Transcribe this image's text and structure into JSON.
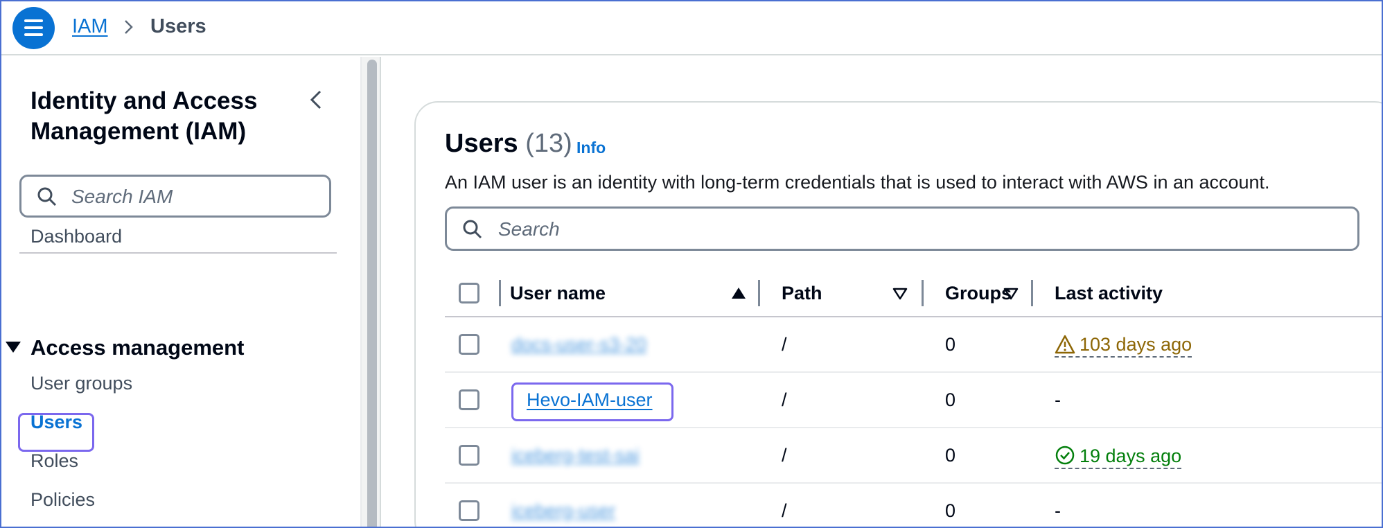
{
  "breadcrumb": {
    "root": "IAM",
    "current": "Users"
  },
  "sidebar": {
    "title": "Identity and Access Management (IAM)",
    "search_placeholder": "Search IAM",
    "dashboard": "Dashboard",
    "section_heading": "Access management",
    "items": [
      {
        "label": "User groups"
      },
      {
        "label": "Users",
        "active": true
      },
      {
        "label": "Roles"
      },
      {
        "label": "Policies"
      }
    ]
  },
  "main": {
    "title": "Users",
    "count": "(13)",
    "info_label": "Info",
    "description": "An IAM user is an identity with long-term credentials that is used to interact with AWS in an account.",
    "search_placeholder": "Search",
    "columns": {
      "user_name": "User name",
      "path": "Path",
      "groups": "Groups",
      "last_activity": "Last activity"
    },
    "rows": [
      {
        "user_name": "docs-user-s3-20",
        "blurred": true,
        "path": "/",
        "groups": "0",
        "last_activity": "103 days ago",
        "activity_status": "warning"
      },
      {
        "user_name": "Hevo-IAM-user",
        "blurred": false,
        "highlighted": true,
        "path": "/",
        "groups": "0",
        "last_activity": "-",
        "activity_status": "none"
      },
      {
        "user_name": "iceberg-test-sai",
        "blurred": true,
        "path": "/",
        "groups": "0",
        "last_activity": "19 days ago",
        "activity_status": "success"
      },
      {
        "user_name": "iceberg-user",
        "blurred": true,
        "path": "/",
        "groups": "0",
        "last_activity": "-",
        "activity_status": "none"
      }
    ]
  },
  "icons": [
    "menu-icon",
    "chevron-right-icon",
    "chevron-left-icon",
    "search-icon",
    "caret-down-icon",
    "sort-ascending-icon",
    "sort-descending-icon",
    "warning-icon",
    "check-circle-icon"
  ],
  "colors": {
    "accent": "#0972d3",
    "highlight": "#7b68ee",
    "warning": "#8d6605",
    "success": "#037f0c"
  }
}
